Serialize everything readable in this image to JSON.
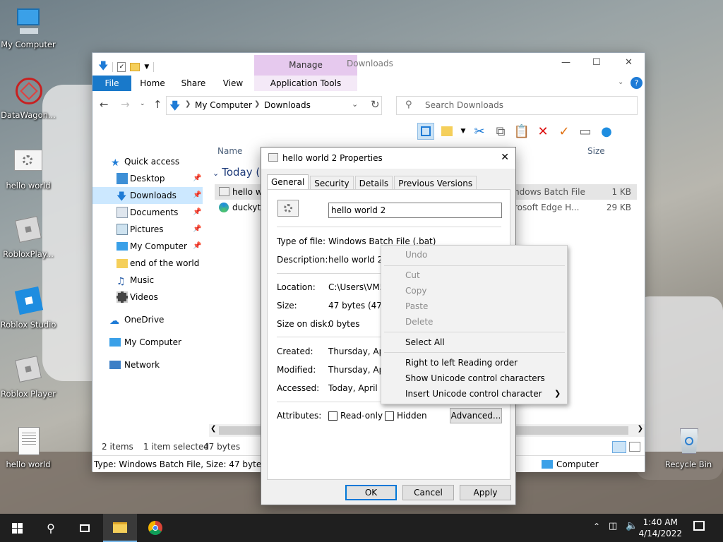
{
  "desktop": {
    "icons": [
      {
        "label": "My Computer"
      },
      {
        "label": "DataWagon..."
      },
      {
        "label": "hello world"
      },
      {
        "label": "RobloxPlay..."
      },
      {
        "label": "Roblox Studio"
      },
      {
        "label": "Roblox Player"
      },
      {
        "label": "hello world"
      },
      {
        "label": "Recycle Bin"
      }
    ]
  },
  "explorer": {
    "contextual_tab": "Manage",
    "window_title": "Downloads",
    "tabs": [
      "File",
      "Home",
      "Share",
      "View",
      "Application Tools"
    ],
    "breadcrumb": [
      "My Computer",
      "Downloads"
    ],
    "search_placeholder": "Search Downloads",
    "nav": [
      {
        "label": "Quick access"
      },
      {
        "label": "Desktop"
      },
      {
        "label": "Downloads"
      },
      {
        "label": "Documents"
      },
      {
        "label": "Pictures"
      },
      {
        "label": "My Computer"
      },
      {
        "label": "end of the world"
      },
      {
        "label": "Music"
      },
      {
        "label": "Videos"
      },
      {
        "label": "OneDrive"
      },
      {
        "label": "My Computer"
      },
      {
        "label": "Network"
      }
    ],
    "columns": {
      "name": "Name",
      "size": "Size"
    },
    "group": "Today (2",
    "files": [
      {
        "name": "hello wo",
        "type": "ndows Batch File",
        "size": "1 KB"
      },
      {
        "name": "duckyta",
        "type": "rosoft Edge H...",
        "size": "29 KB"
      }
    ],
    "status": {
      "items": "2 items",
      "selected": "1 item selected",
      "size": "47 bytes"
    },
    "details": "Type: Windows Batch File, Size: 47 bytes, Date",
    "details_location": "Computer"
  },
  "dialog": {
    "title": "hello world 2 Properties",
    "tabs": [
      "General",
      "Security",
      "Details",
      "Previous Versions"
    ],
    "name_value": "hello world 2",
    "fields": {
      "type_label": "Type of file:",
      "type_value": "Windows Batch File (.bat)",
      "desc_label": "Description:",
      "desc_value": "hello world 2",
      "location_label": "Location:",
      "location_value": "C:\\Users\\VM5\\",
      "size_label": "Size:",
      "size_value": "47 bytes (47 by",
      "disk_label": "Size on disk:",
      "disk_value": "0 bytes",
      "created_label": "Created:",
      "created_value": "Thursday, April 1",
      "modified_label": "Modified:",
      "modified_value": "Thursday, April 1",
      "accessed_label": "Accessed:",
      "accessed_value": "Today, April 14,",
      "attr_label": "Attributes:",
      "readonly": "Read-only",
      "hidden": "Hidden",
      "advanced": "Advanced..."
    },
    "buttons": {
      "ok": "OK",
      "cancel": "Cancel",
      "apply": "Apply"
    }
  },
  "context_menu": {
    "undo": "Undo",
    "cut": "Cut",
    "copy": "Copy",
    "paste": "Paste",
    "delete": "Delete",
    "select_all": "Select All",
    "rtl": "Right to left Reading order",
    "show_unicode": "Show Unicode control characters",
    "insert_unicode": "Insert Unicode control character"
  },
  "taskbar": {
    "time": "1:40 AM",
    "date": "4/14/2022"
  },
  "colors": {
    "accent": "#1979ca",
    "manage": "#e6c9ee",
    "taskbar": "#1f1f1f"
  }
}
